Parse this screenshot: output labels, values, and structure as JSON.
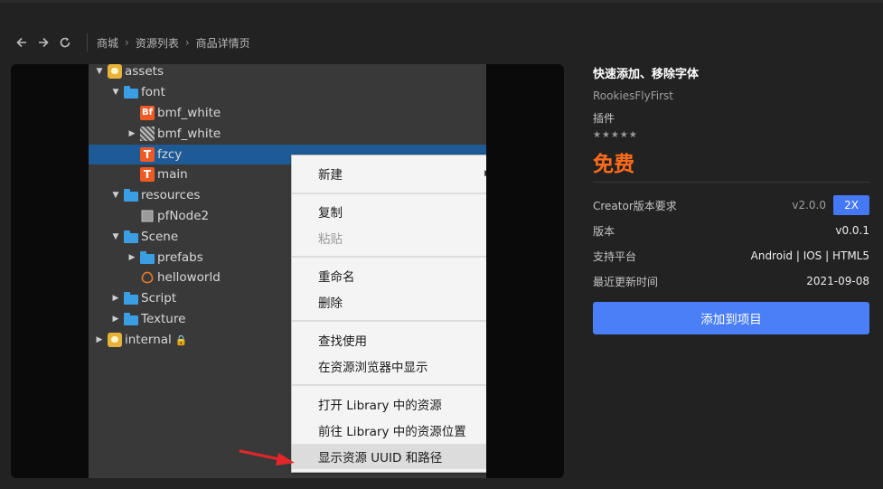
{
  "toolbar": {
    "back_icon": "arrow-left-icon",
    "forward_icon": "arrow-right-icon",
    "refresh_icon": "refresh-icon",
    "breadcrumbs": [
      "商城",
      "资源列表",
      "商品详情页"
    ]
  },
  "preview": {
    "tree": [
      {
        "label": "assets",
        "icon": "database-icon",
        "expanded": true
      },
      {
        "label": "font",
        "icon": "folder-icon",
        "expanded": true
      },
      {
        "label": "bmf_white",
        "icon": "bitmap-font-icon"
      },
      {
        "label": "bmf_white",
        "icon": "texture-icon",
        "collapsed": true
      },
      {
        "label": "fzcy",
        "icon": "ttf-font-icon",
        "selected": true
      },
      {
        "label": "main",
        "icon": "ttf-font-icon"
      },
      {
        "label": "resources",
        "icon": "folder-icon",
        "expanded": true
      },
      {
        "label": "pfNode2",
        "icon": "prefab-icon"
      },
      {
        "label": "Scene",
        "icon": "folder-icon",
        "expanded": true
      },
      {
        "label": "prefabs",
        "icon": "folder-icon",
        "collapsed": true
      },
      {
        "label": "helloworld",
        "icon": "scene-icon"
      },
      {
        "label": "Script",
        "icon": "folder-icon",
        "collapsed": true
      },
      {
        "label": "Texture",
        "icon": "folder-icon",
        "collapsed": true
      },
      {
        "label": "internal",
        "icon": "database-icon",
        "collapsed": true,
        "locked": true
      }
    ],
    "context_menu": [
      {
        "label": "新建",
        "submenu": true
      },
      {
        "label": "复制"
      },
      {
        "label": "粘贴",
        "disabled": true
      },
      {
        "label": "重命名"
      },
      {
        "label": "删除"
      },
      {
        "label": "查找使用"
      },
      {
        "label": "在资源浏览器中显示"
      },
      {
        "label": "打开 Library 中的资源"
      },
      {
        "label": "前往 Library 中的资源位置"
      },
      {
        "label": "显示资源 UUID 和路径",
        "highlighted": true
      }
    ]
  },
  "product": {
    "title": "快速添加、移除字体",
    "author": "RookiesFlyFirst",
    "category": "插件",
    "rating_stars": 5,
    "rating_glyphs": "★★★★★",
    "price": "免费",
    "creator_label": "Creator版本要求",
    "creator_version": "v2.0.0",
    "creator_badge": "2X",
    "version_label": "版本",
    "version_value": "v0.0.1",
    "platform_label": "支持平台",
    "platform_value": "Android | IOS | HTML5",
    "updated_label": "最近更新时间",
    "updated_value": "2021-09-08",
    "add_button": "添加到项目"
  },
  "colors": {
    "accent": "#4a7ff7",
    "price": "#ff6b1a",
    "selection": "#1d5a96"
  }
}
